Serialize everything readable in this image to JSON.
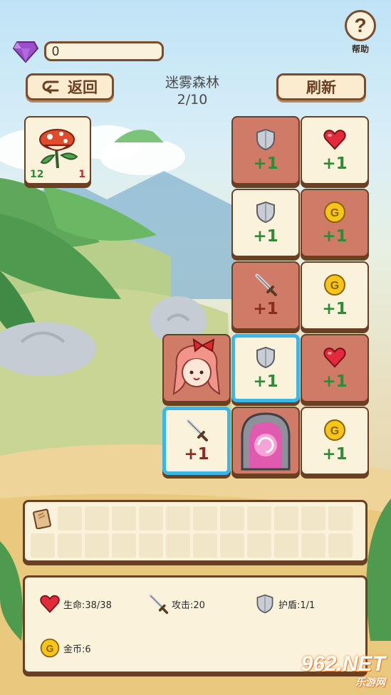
{
  "currency": {
    "gems": "0",
    "gem_color": "#9b4fc9"
  },
  "help": {
    "label": "帮助",
    "glyph": "?"
  },
  "nav": {
    "back_label": "返回",
    "refresh_label": "刷新",
    "back_icon": "return-arrow-icon"
  },
  "stage": {
    "name": "迷雾森林",
    "progress": "2/10"
  },
  "monster": {
    "name": "piranha-plant",
    "hp": "12",
    "attack": "1"
  },
  "board": {
    "tiles": [
      {
        "kind": "shield",
        "value": "+1",
        "bg": "red",
        "selected": false
      },
      {
        "kind": "heart",
        "value": "+1",
        "bg": "cream",
        "selected": false
      },
      {
        "kind": "shield",
        "value": "+1",
        "bg": "cream",
        "selected": false
      },
      {
        "kind": "coin",
        "value": "+1",
        "bg": "red",
        "selected": false
      },
      {
        "kind": "sword",
        "value": "+1",
        "bg": "red",
        "selected": false
      },
      {
        "kind": "coin",
        "value": "+1",
        "bg": "cream",
        "selected": false
      },
      {
        "kind": "hero",
        "value": "",
        "bg": "red",
        "selected": false
      },
      {
        "kind": "shield",
        "value": "+1",
        "bg": "cream",
        "selected": true
      },
      {
        "kind": "heart",
        "value": "+1",
        "bg": "red",
        "selected": false
      },
      {
        "kind": "sword",
        "value": "+1",
        "bg": "cream",
        "selected": true
      },
      {
        "kind": "portal",
        "value": "",
        "bg": "red",
        "selected": false
      },
      {
        "kind": "coin",
        "value": "+1",
        "bg": "cream",
        "selected": false
      }
    ]
  },
  "inventory": {
    "first_item": "spellbook-icon",
    "slot_count": 24
  },
  "stats": {
    "hp": "生命:38/38",
    "attack": "攻击:20",
    "shield": "护盾:1/1",
    "gold": "金币:6"
  },
  "watermark": {
    "big": "962.NET",
    "small": "乐游网"
  },
  "colors": {
    "tile_red": "#d07a68",
    "tile_cream": "#fbf2dc",
    "border_brown": "#6b3f22",
    "select_blue": "#3ab6ea",
    "plus_green": "#2f8b35",
    "plus_red": "#8a2b1f"
  }
}
